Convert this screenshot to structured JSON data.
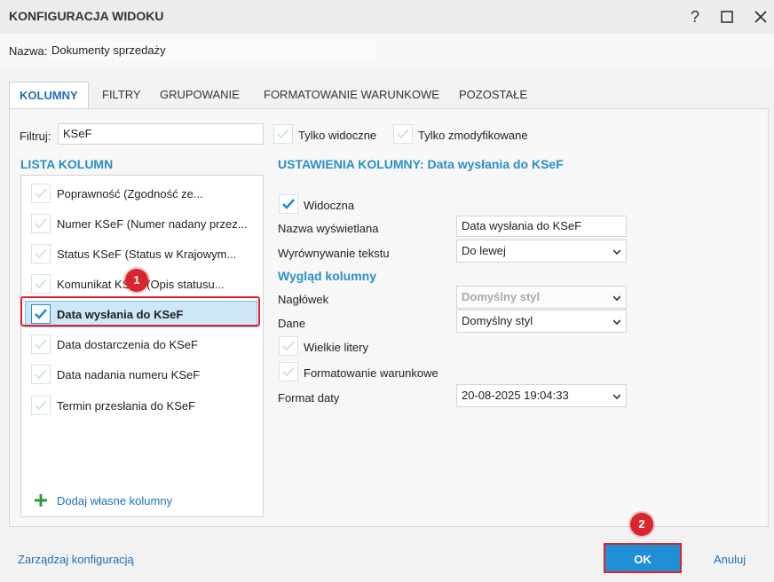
{
  "window": {
    "title": "KONFIGURACJA WIDOKU",
    "help": "?",
    "maximize": "☐",
    "close": "✕"
  },
  "name_row": {
    "label": "Nazwa:",
    "value": "Dokumenty sprzedaży"
  },
  "tabs": [
    {
      "label": "KOLUMNY",
      "active": true
    },
    {
      "label": "FILTRY"
    },
    {
      "label": "GRUPOWANIE"
    },
    {
      "label": "FORMATOWANIE WARUNKOWE"
    },
    {
      "label": "POZOSTAŁE"
    }
  ],
  "filter": {
    "label": "Filtruj:",
    "value": "KSeF",
    "only_visible": "Tylko widoczne",
    "only_modified": "Tylko zmodyfikowane"
  },
  "column_list": {
    "title": "LISTA KOLUMN",
    "items": [
      {
        "label": "Poprawność (Zgodność ze...",
        "checked": false
      },
      {
        "label": "Numer KSeF (Numer nadany przez...",
        "checked": false
      },
      {
        "label": "Status KSeF (Status w Krajowym...",
        "checked": false
      },
      {
        "label": "Komunikat KSeF (Opis statusu...",
        "checked": false
      },
      {
        "label": "Data wysłania do KSeF",
        "checked": true,
        "selected": true
      },
      {
        "label": "Data dostarczenia do KSeF",
        "checked": false
      },
      {
        "label": "Data nadania numeru KSeF",
        "checked": false
      },
      {
        "label": "Termin przesłania do KSeF",
        "checked": false
      }
    ],
    "add_custom": "Dodaj własne kolumny"
  },
  "settings": {
    "title": "USTAWIENIA KOLUMNY: Data wysłania do KSeF",
    "visible_label": "Widoczna",
    "display_name_label": "Nazwa wyświetlana",
    "display_name_value": "Data wysłania do KSeF",
    "align_label": "Wyrównywanie tekstu",
    "align_value": "Do lewej",
    "appearance_title": "Wygląd kolumny",
    "header_label": "Nagłówek",
    "header_value": "Domyślny styl",
    "data_label": "Dane",
    "data_value": "Domyślny styl",
    "uppercase_label": "Wielkie litery",
    "cond_format_label": "Formatowanie warunkowe",
    "date_format_label": "Format daty",
    "date_format_value": "20-08-2025 19:04:33"
  },
  "badges": {
    "one": "1",
    "two": "2"
  },
  "footer": {
    "manage": "Zarządzaj konfiguracją",
    "ok": "OK",
    "cancel": "Anuluj"
  },
  "colors": {
    "accent": "#1f8fd6",
    "section": "#2a8fc6",
    "highlight": "#e0222a",
    "add_icon": "#2e9b3a"
  }
}
